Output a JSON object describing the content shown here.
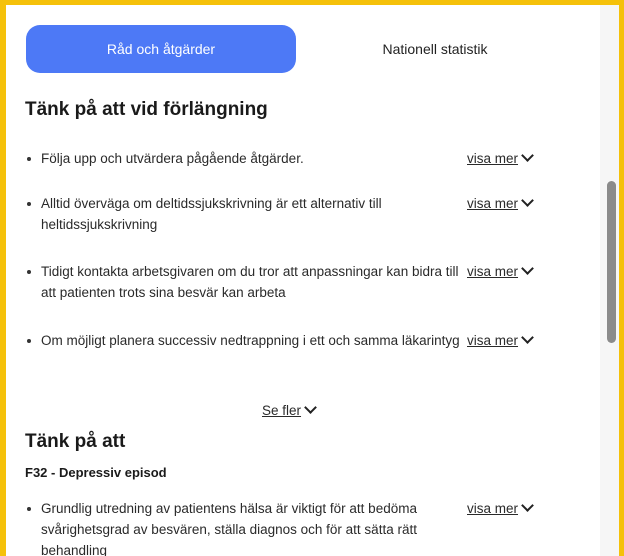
{
  "tabs": {
    "active_label": "Råd och åtgärder",
    "inactive_label": "Nationell statistik"
  },
  "section1": {
    "title": "Tänk på att vid förlängning",
    "items": [
      {
        "text": "Följa upp och utvärdera pågående åtgärder.",
        "more": "visa mer"
      },
      {
        "text": "Alltid överväga om deltidssjukskrivning är ett alternativ till heltidssjukskrivning",
        "more": "visa mer"
      },
      {
        "text": "Tidigt kontakta arbetsgivaren om du tror att anpassningar kan bidra till att patienten trots sina besvär kan arbeta",
        "more": "visa mer"
      },
      {
        "text": "Om möjligt planera successiv nedtrappning i ett och samma läkarintyg",
        "more": "visa mer"
      }
    ],
    "see_more": "Se fler"
  },
  "section2": {
    "title": "Tänk på att",
    "diagnosis": "F32 - Depressiv episod",
    "items": [
      {
        "text": "Grundlig utredning av patientens hälsa är viktigt för att bedöma svårighetsgrad av besvären, ställa diagnos och för att sätta rätt behandling",
        "more": "visa mer"
      }
    ]
  },
  "colors": {
    "accent_border": "#f5c10a",
    "tab_active": "#4d79f6"
  },
  "icons": {
    "expand": "chevron-down-icon"
  }
}
